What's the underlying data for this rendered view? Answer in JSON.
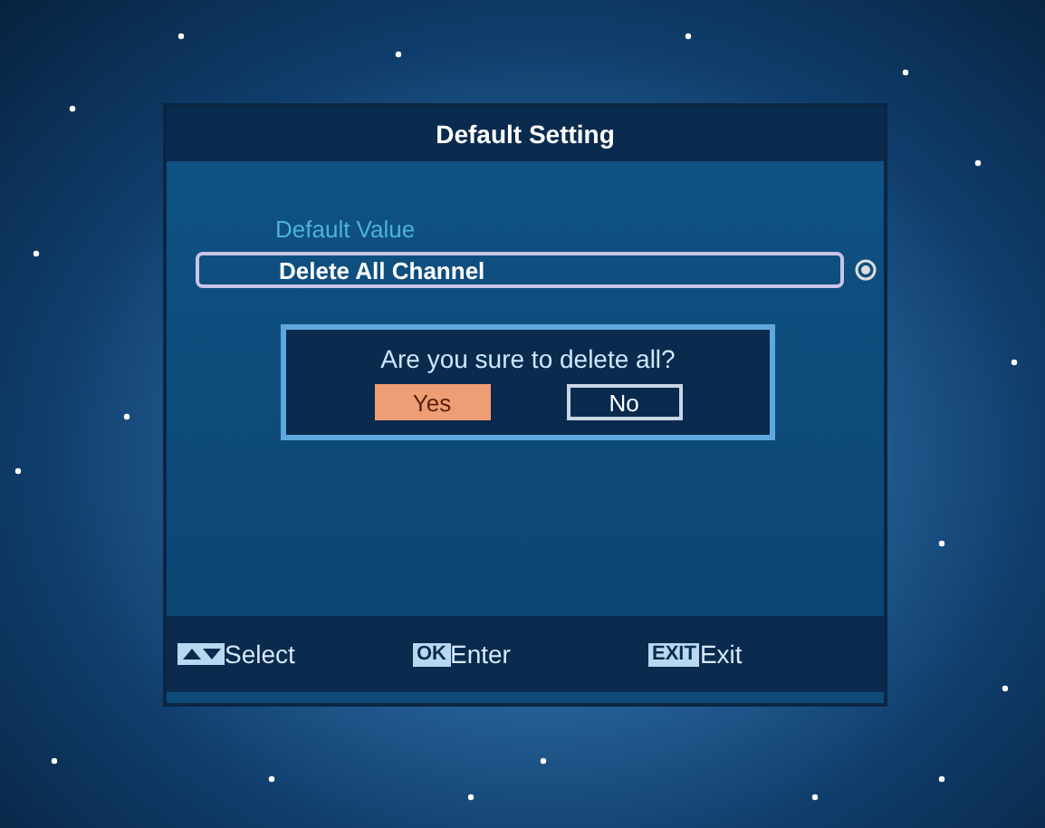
{
  "window": {
    "title": "Default Setting"
  },
  "section_label": "Default Value",
  "menu_items": [
    {
      "label": "Delete All Channel",
      "selected": true
    }
  ],
  "dialog": {
    "message": "Are you sure to delete all?",
    "buttons": [
      {
        "label": "Yes",
        "selected": true
      },
      {
        "label": "No",
        "selected": false
      }
    ]
  },
  "footer": [
    {
      "kind": "arrows",
      "label": "Select"
    },
    {
      "kind": "key",
      "key": "OK",
      "label": "Enter"
    },
    {
      "kind": "key",
      "key": "EXIT",
      "label": "Exit"
    }
  ]
}
